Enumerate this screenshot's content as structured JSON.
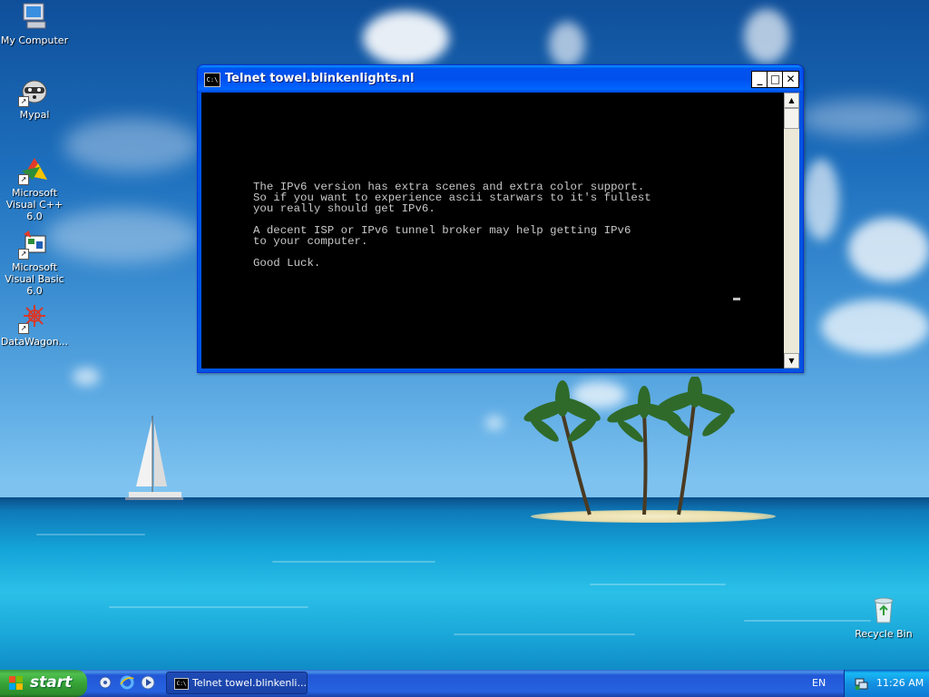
{
  "desktop": {
    "icons": [
      {
        "label": "My Computer"
      },
      {
        "label": "Mypal"
      },
      {
        "label": "Microsoft Visual C++ 6.0"
      },
      {
        "label": "Microsoft Visual Basic 6.0"
      },
      {
        "label": "DataWagon..."
      },
      {
        "label": "Recycle Bin"
      }
    ]
  },
  "window": {
    "title": "Telnet towel.blinkenlights.nl",
    "icon_text": "C:\\",
    "console_text": "The IPv6 version has extra scenes and extra color support.\nSo if you want to experience ascii starwars to it's fullest\nyou really should get IPv6.\n\nA decent ISP or IPv6 tunnel broker may help getting IPv6\nto your computer.\n\nGood Luck.",
    "buttons": {
      "minimize": "_",
      "maximize": "□",
      "close": "✕"
    }
  },
  "taskbar": {
    "start_label": "start",
    "task_button_label": "Telnet towel.blinkenli...",
    "language": "EN",
    "clock": "11:26 AM"
  },
  "colors": {
    "titlebar": "#0054e3",
    "taskbar": "#245edb",
    "start_button": "#3a9b3a",
    "console_bg": "#000000",
    "console_fg": "#c0c0c0"
  }
}
